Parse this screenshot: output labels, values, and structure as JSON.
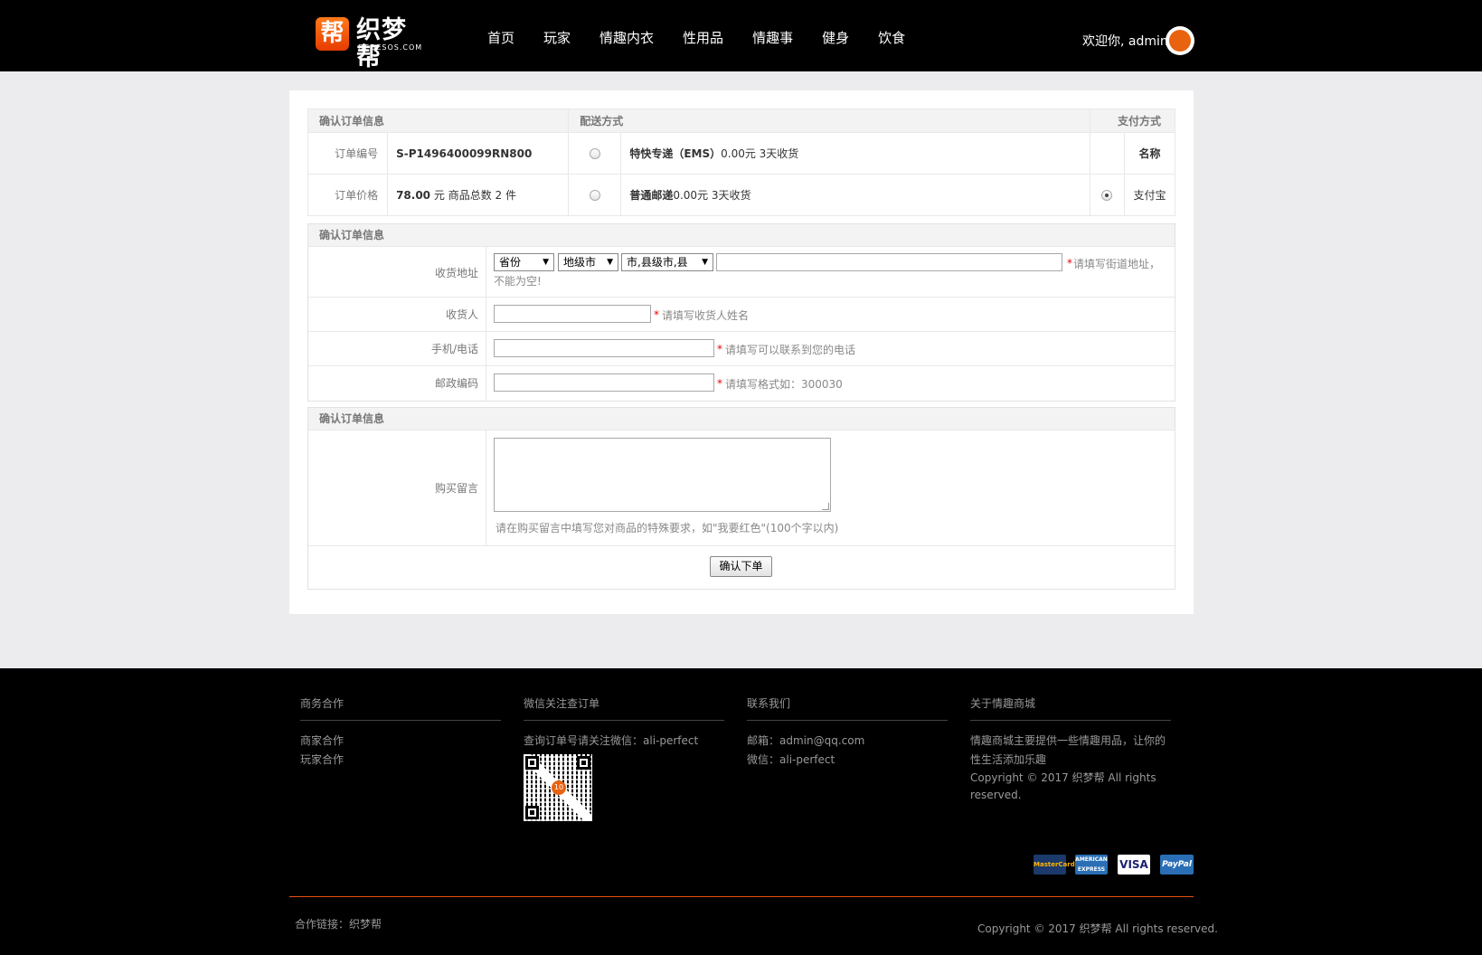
{
  "header": {
    "logo_badge": "帮",
    "logo_text": "织梦帮",
    "logo_sub": "DEDESOS.COM",
    "nav": [
      "首页",
      "玩家",
      "情趣内衣",
      "性用品",
      "情趣事",
      "健身",
      "饮食"
    ],
    "welcome": "欢迎你, admin"
  },
  "order": {
    "head_info": "确认订单信息",
    "head_shipping": "配送方式",
    "head_payment": "支付方式",
    "order_no_label": "订单编号",
    "order_no": "S-P1496400099RN800",
    "price_label": "订单价格",
    "price_value": "78.00",
    "price_unit": "元 商品总数 2 件",
    "ship1_name": "特快专递（EMS）",
    "ship1_detail": "0.00元 3天收货",
    "ship2_name": "普通邮递",
    "ship2_detail": "0.00元 3天收货",
    "pay_col_name": "名称",
    "pay_option": "支付宝"
  },
  "address": {
    "head": "确认订单信息",
    "addr_label": "收货地址",
    "province": "省份",
    "city": "地级市",
    "county": "市,县级市,县",
    "addr_hint": "请填写街道地址，",
    "addr_hint2": "不能为空!",
    "receiver_label": "收货人",
    "receiver_hint": "请填写收货人姓名",
    "phone_label": "手机/电话",
    "phone_hint": "请填写可以联系到您的电话",
    "zip_label": "邮政编码",
    "zip_hint": "请填写格式如：300030",
    "star": "*"
  },
  "message": {
    "head": "确认订单信息",
    "label": "购买留言",
    "hint": "请在购买留言中填写您对商品的特殊要求，如\"我要红色\"(100个字以内)",
    "submit": "确认下单"
  },
  "footer": {
    "col1_title": "商务合作",
    "col1_items": [
      "商家合作",
      "玩家合作"
    ],
    "col2_title": "微信关注查订单",
    "col2_text": "查询订单号请关注微信：ali-perfect",
    "qr_badge": "10",
    "col3_title": "联系我们",
    "col3_items": [
      "邮箱：admin@qq.com",
      "微信：ali-perfect"
    ],
    "col4_title": "关于情趣商城",
    "col4_text1": "情趣商城主要提供一些情趣用品，让你的",
    "col4_text2": "性生活添加乐趣",
    "col4_text3": "Copyright © 2017 织梦帮 All rights",
    "col4_text4": "reserved.",
    "payments": [
      "MasterCard",
      "AMERICAN EXPRESS",
      "VISA",
      "PayPal"
    ],
    "link": "合作链接：织梦帮",
    "copyright": "Copyright © 2017 织梦帮 All rights reserved."
  }
}
